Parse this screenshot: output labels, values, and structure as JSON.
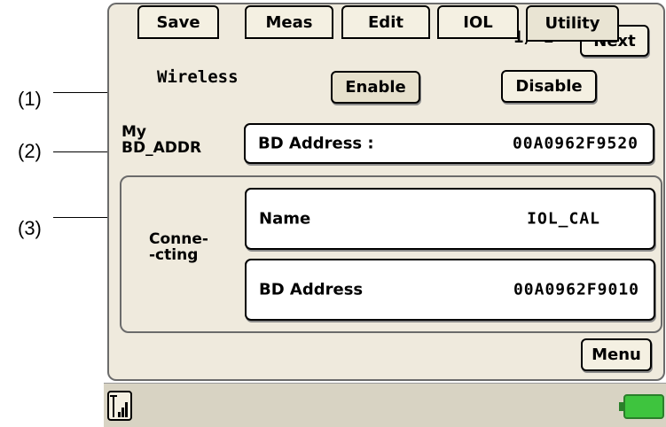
{
  "callouts": [
    "(1)",
    "(2)",
    "(3)"
  ],
  "header": {
    "page_indicator": "1/ 2",
    "next_label": "Next"
  },
  "wireless": {
    "label": "Wireless",
    "enable_label": "Enable",
    "disable_label": "Disable"
  },
  "my_addr": {
    "label_line1": "My",
    "label_line2": "BD_ADDR",
    "field_label": "BD Address :",
    "field_value": "00A0962F9520"
  },
  "connecting": {
    "label_line1": "Conne-",
    "label_line2": "-cting",
    "name_label": "Name",
    "name_value": "IOL_CAL",
    "addr_label": "BD Address",
    "addr_value": "00A0962F9010"
  },
  "menu_label": "Menu",
  "tabs": [
    "Save",
    "Meas",
    "Edit",
    "IOL",
    "Utility"
  ],
  "selected_tab": "Utility",
  "icons": {
    "signal": "signal-icon",
    "battery": "battery-icon"
  },
  "colors": {
    "screen_bg": "#efeadd",
    "battery": "#3ec43e"
  }
}
